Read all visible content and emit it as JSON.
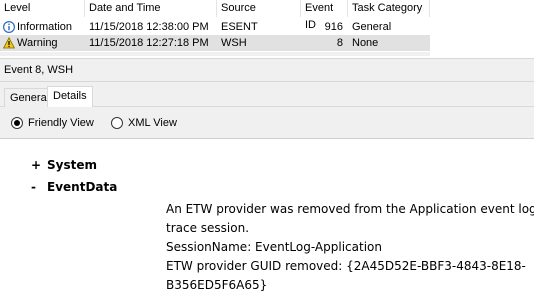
{
  "list": {
    "columns": [
      "Level",
      "Date and Time",
      "Source",
      "Event ID",
      "Task Category"
    ],
    "rows": [
      {
        "level": "Information",
        "level_icon": "info-icon",
        "datetime": "11/15/2018 12:38:00 PM",
        "source": "ESENT",
        "event_id": "916",
        "task_category": "General"
      },
      {
        "level": "Warning",
        "level_icon": "warning-icon",
        "datetime": "11/15/2018 12:27:18 PM",
        "source": "WSH",
        "event_id": "8",
        "task_category": "None"
      }
    ]
  },
  "detail": {
    "title": "Event 8, WSH",
    "tabs": [
      "General",
      "Details"
    ],
    "active_tab": "Details",
    "view_options": [
      "Friendly View",
      "XML View"
    ],
    "selected_view": "Friendly View",
    "nodes": [
      {
        "expander": "+",
        "label": "System"
      },
      {
        "expander": "-",
        "label": "EventData"
      }
    ],
    "message_lines": [
      "An ETW provider was removed from the Application event log",
      "trace session.",
      "SessionName: EventLog-Application",
      "ETW provider GUID removed: {2A45D52E-BBF3-4843-8E18-",
      "B356ED5F6A65}"
    ]
  },
  "colors": {
    "selected_row": "#e1e1e1",
    "panel_bg": "#f0f0f0",
    "info_blue": "#2b6cc4",
    "warning_yellow": "#f2c811"
  }
}
